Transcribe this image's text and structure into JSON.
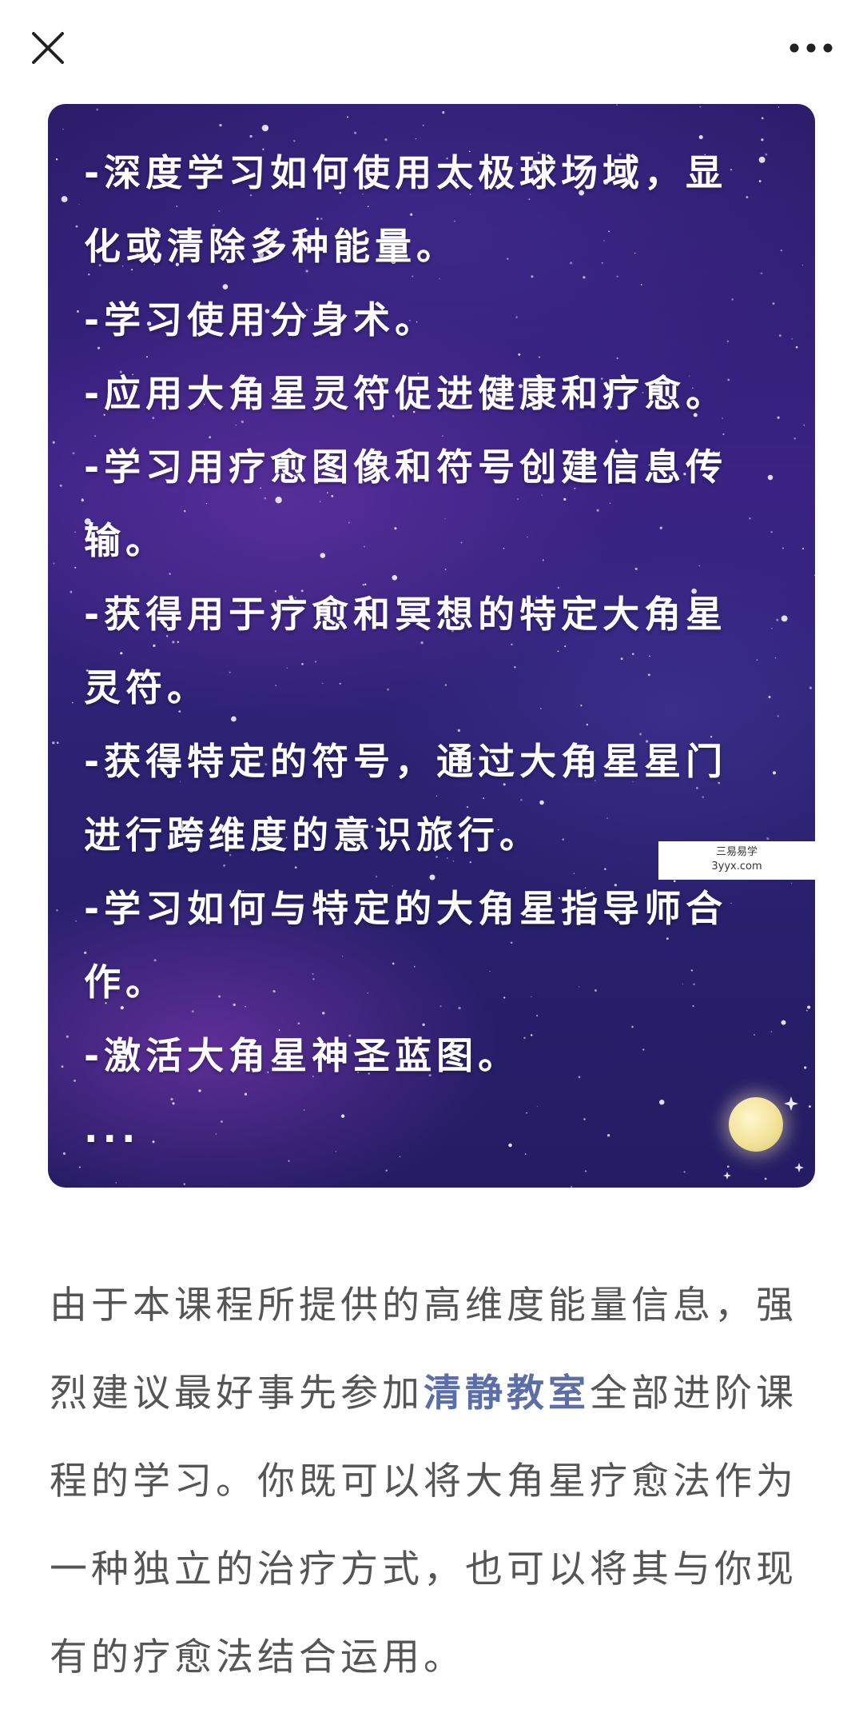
{
  "topbar": {
    "close_icon": "close-icon",
    "more_icon": "more-horizontal-icon"
  },
  "card": {
    "lines": [
      "-深度学习如何使用太极球场域，显",
      "化或清除多种能量。",
      "-学习使用分身术。",
      "-应用大角星灵符促进健康和疗愈。",
      "-学习用疗愈图像和符号创建信息传",
      "输。",
      "-获得用于疗愈和冥想的特定大角星",
      "灵符。",
      "-获得特定的符号，通过大角星星门",
      "进行跨维度的意识旅行。",
      "-学习如何与特定的大角星指导师合",
      "作。",
      "-激活大角星神圣蓝图。",
      "..."
    ],
    "bg_color": "#2f2277"
  },
  "watermark": {
    "line1": "三易易学",
    "line2": "3yyx.com"
  },
  "paragraph": {
    "row1": "由于本课程所提供的高维度能量信息，强",
    "row2_before": "烈建议最好事先参加",
    "row2_link": "清静教室",
    "row2_after": "全部进阶课",
    "row3": "程的学习。你既可以将大角星疗愈法作为",
    "row4": "一种独立的治疗方式，也可以将其与你现",
    "row5": "有的疗愈法结合运用。",
    "link_color": "#5b6ea8"
  }
}
